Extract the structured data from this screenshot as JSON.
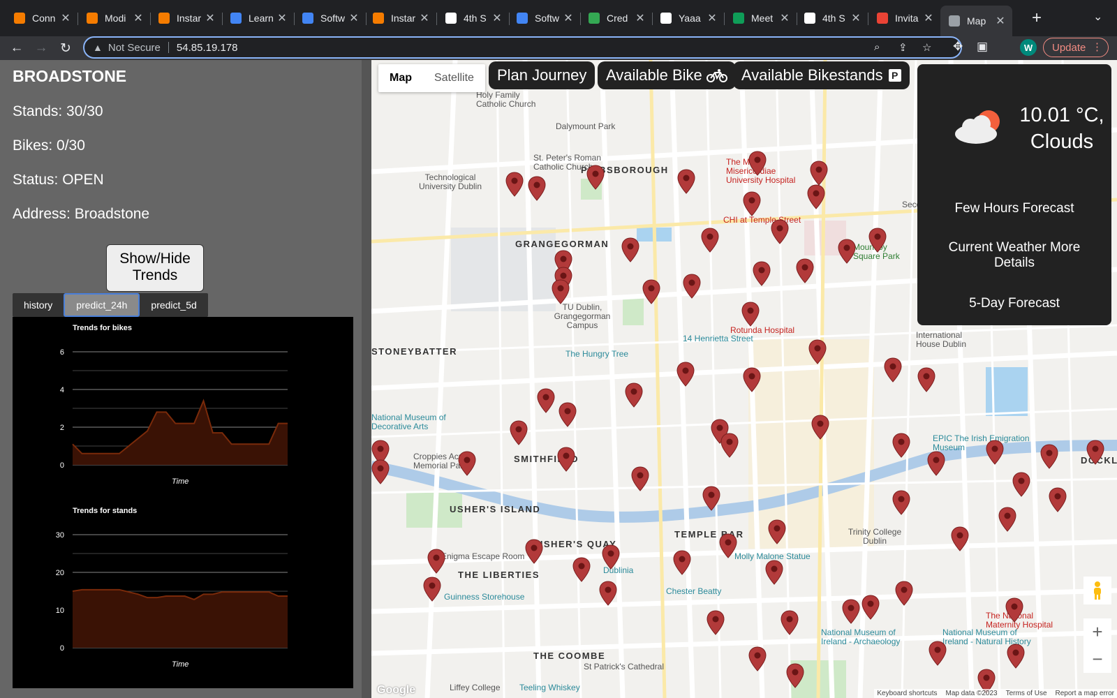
{
  "browser": {
    "tabs": [
      {
        "title": "Conn",
        "icon": "orange-square-icon",
        "color": "#f57c00"
      },
      {
        "title": "Modi",
        "icon": "orange-square-icon",
        "color": "#f57c00"
      },
      {
        "title": "Instar",
        "icon": "orange-square-icon",
        "color": "#f57c00"
      },
      {
        "title": "Learn",
        "icon": "google-docs-icon",
        "color": "#4285f4"
      },
      {
        "title": "Softw",
        "icon": "google-docs-icon",
        "color": "#4285f4"
      },
      {
        "title": "Instar",
        "icon": "orange-square-icon",
        "color": "#f57c00"
      },
      {
        "title": "4th S",
        "icon": "trello-icon",
        "color": "#ffffff"
      },
      {
        "title": "Softw",
        "icon": "google-docs-icon",
        "color": "#4285f4"
      },
      {
        "title": "Cred",
        "icon": "google-maps-icon",
        "color": "#34a853"
      },
      {
        "title": "Yaaa",
        "icon": "github-icon",
        "color": "#ffffff"
      },
      {
        "title": "Meet",
        "icon": "google-sheets-icon",
        "color": "#0f9d58"
      },
      {
        "title": "4th S",
        "icon": "trello-icon",
        "color": "#ffffff"
      },
      {
        "title": "Invita",
        "icon": "gmail-icon",
        "color": "#ea4335"
      },
      {
        "title": "Map",
        "icon": "globe-icon",
        "color": "#9aa0a6",
        "active": true
      }
    ],
    "security_label": "Not Secure",
    "url": "54.85.19.178",
    "profile_initial": "W",
    "update_label": "Update"
  },
  "station": {
    "name": "BROADSTONE",
    "stands": "Stands: 30/30",
    "bikes": "Bikes: 0/30",
    "status": "Status: OPEN",
    "address": "Address: Broadstone"
  },
  "controls": {
    "trends_button": "Show/Hide Trends",
    "tabs": [
      "history",
      "predict_24h",
      "predict_5d"
    ],
    "selected_tab": "predict_24h"
  },
  "chart_data": [
    {
      "type": "area",
      "title": "Trends for bikes",
      "xlabel": "Time",
      "ylabel": "",
      "ylim": [
        0,
        6
      ],
      "yticks": [
        0,
        2,
        4,
        6
      ],
      "color": "#7a2a0a",
      "values": [
        1.1,
        0.6,
        0.6,
        0.6,
        0.6,
        0.6,
        1.0,
        1.4,
        1.8,
        2.8,
        2.8,
        2.2,
        2.2,
        2.2,
        3.4,
        1.7,
        1.7,
        1.1,
        1.1,
        1.1,
        1.1,
        1.1,
        2.2,
        2.2
      ]
    },
    {
      "type": "area",
      "title": "Trends for stands",
      "xlabel": "Time",
      "ylabel": "",
      "ylim": [
        0,
        30
      ],
      "yticks": [
        0,
        10,
        20,
        30
      ],
      "color": "#7a2a0a",
      "values": [
        15,
        15.4,
        15.4,
        15.4,
        15.4,
        15.4,
        14.8,
        14.2,
        13.3,
        13.3,
        13.7,
        13.7,
        13.7,
        12.8,
        14.2,
        14.2,
        14.8,
        14.8,
        14.8,
        14.8,
        14.8,
        14.8,
        13.7,
        13.7
      ]
    }
  ],
  "map": {
    "map_type": [
      "Map",
      "Satellite"
    ],
    "buttons": {
      "plan": "Plan Journey",
      "bikes": "Available Bike",
      "bikestands": "Available Bikestands"
    },
    "weather": {
      "temp": "10.01 °C,",
      "desc": "Clouds",
      "links": [
        "Few Hours Forecast",
        "Current Weather More Details",
        "5-Day Forecast"
      ]
    },
    "labels": {
      "phibsborough": "PHIBSBOROUGH",
      "grangegorman": "GRANGEGORMAN",
      "stoneybatter": "STONEYBATTER",
      "smithfield": "SMITHFIELD",
      "ushers_island": "USHER'S ISLAND",
      "ushers_quay": "USHER'S QUAY",
      "liberties": "THE LIBERTIES",
      "temple_bar": "TEMPLE BAR",
      "coombe": "THE COOMBE",
      "dockland": "DOCKLAND",
      "dalymount": "Dalymount Park",
      "rotunda": "Rotunda Hospital",
      "mater": "The Mater Misericordiae University Hospital",
      "hungry_tree": "The Hungry Tree",
      "henrietta": "14 Henrietta Street",
      "guinness": "Guinness Storehouse",
      "dublinia": "Dublinia",
      "chester_beatty": "Chester Beatty",
      "molly_malone": "Molly Malone Statue",
      "trinity": "Trinity College Dublin",
      "epic": "EPIC The Irish Emigration Museum",
      "natmuseum_arch": "National Museum of Ireland - Archaeology",
      "natmuseum_nat": "National Museum of Ireland - Natural History",
      "maternity": "The National Maternity Hospital",
      "st_patricks": "St Patrick's Cathedral",
      "tu_dublin": "TU Dublin, Grangegorman Campus",
      "tech_uni": "Technological University Dublin",
      "croppies": "Croppies Acre Memorial Park",
      "natmuseum_deco": "National Museum of Decorative Arts",
      "st_peters": "St. Peter's Roman Catholic Church",
      "holy_family": "Holy Family Catholic Church",
      "liffey_college": "Liffey College",
      "teeling": "Teeling Whiskey",
      "enigma": "Enigma Escape Room",
      "chi": "CHI at Temple Street",
      "mountjoy": "Mountjoy Square Park",
      "intl_house": "International House Dublin",
      "collect": "Second"
    },
    "attribution": [
      "Keyboard shortcuts",
      "Map data ©2023",
      "Terms of Use",
      "Report a map error"
    ],
    "google": "Google"
  }
}
